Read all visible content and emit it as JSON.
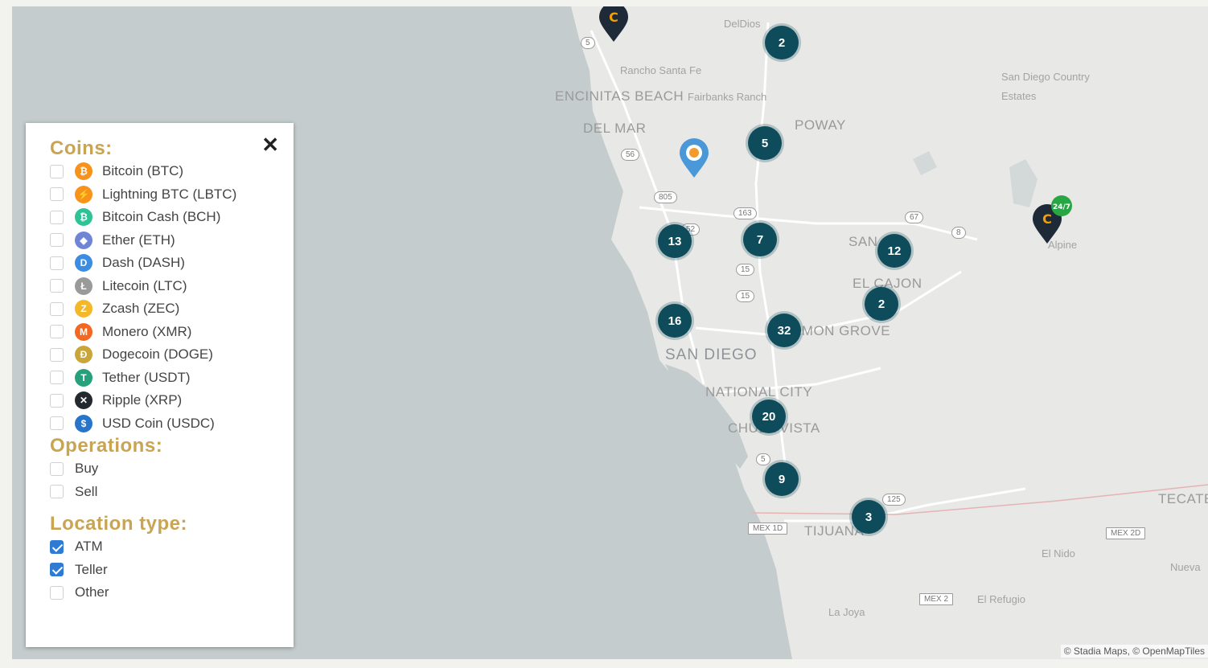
{
  "map": {
    "labels": [
      {
        "text": "DelDios",
        "cls": "small"
      },
      {
        "text": "Rancho Santa Fe",
        "cls": "small"
      },
      {
        "text": "ENCINITAS BEACH",
        "cls": ""
      },
      {
        "text": "Fairbanks Ranch",
        "cls": "small"
      },
      {
        "text": "DEL MAR",
        "cls": ""
      },
      {
        "text": "POWAY",
        "cls": ""
      },
      {
        "text": "San Diego Country Estates",
        "cls": "small"
      },
      {
        "text": "SAN",
        "cls": ""
      },
      {
        "text": "EL CAJON",
        "cls": ""
      },
      {
        "text": "LEMON GROVE",
        "cls": ""
      },
      {
        "text": "SAN DIEGO",
        "cls": "city"
      },
      {
        "text": "NATIONAL CITY",
        "cls": ""
      },
      {
        "text": "CHULA VISTA",
        "cls": ""
      },
      {
        "text": "TIJUANA",
        "cls": ""
      },
      {
        "text": "TECATE",
        "cls": ""
      },
      {
        "text": "Alpine",
        "cls": "small"
      },
      {
        "text": "El Nido",
        "cls": "small"
      },
      {
        "text": "El Refugio",
        "cls": "small"
      },
      {
        "text": "La Joya",
        "cls": "small"
      },
      {
        "text": "Nueva",
        "cls": "small"
      }
    ],
    "shields": [
      "5",
      "56",
      "805",
      "52",
      "163",
      "67",
      "8",
      "15",
      "15",
      "5",
      "125",
      "MEX 1D",
      "MEX 2D",
      "MEX 2"
    ],
    "clusters": [
      "2",
      "5",
      "13",
      "7",
      "12",
      "2",
      "16",
      "32",
      "20",
      "9",
      "3"
    ],
    "attribution": "© Stadia Maps, © OpenMapTiles"
  },
  "panel": {
    "close": "✕",
    "coins_title": "Coins:",
    "coins": [
      {
        "label": "Bitcoin (BTC)",
        "color": "#f7931a",
        "glyph": "₿"
      },
      {
        "label": "Lightning BTC (LBTC)",
        "color": "#f7931a",
        "glyph": "⚡"
      },
      {
        "label": "Bitcoin Cash (BCH)",
        "color": "#2dc396",
        "glyph": "₿"
      },
      {
        "label": "Ether (ETH)",
        "color": "#6f86d6",
        "glyph": "◆"
      },
      {
        "label": "Dash (DASH)",
        "color": "#3c8de1",
        "glyph": "D"
      },
      {
        "label": "Litecoin (LTC)",
        "color": "#9a9a9a",
        "glyph": "Ł"
      },
      {
        "label": "Zcash (ZEC)",
        "color": "#f4b728",
        "glyph": "Z"
      },
      {
        "label": "Monero (XMR)",
        "color": "#f26822",
        "glyph": "M"
      },
      {
        "label": "Dogecoin (DOGE)",
        "color": "#c9a63a",
        "glyph": "Ð"
      },
      {
        "label": "Tether (USDT)",
        "color": "#26a17b",
        "glyph": "T"
      },
      {
        "label": "Ripple (XRP)",
        "color": "#23292f",
        "glyph": "✕"
      },
      {
        "label": "USD Coin (USDC)",
        "color": "#2775ca",
        "glyph": "$"
      }
    ],
    "operations_title": "Operations:",
    "operations": [
      {
        "label": "Buy",
        "checked": false
      },
      {
        "label": "Sell",
        "checked": false
      }
    ],
    "location_title": "Location type:",
    "locations": [
      {
        "label": "ATM",
        "checked": true
      },
      {
        "label": "Teller",
        "checked": true
      },
      {
        "label": "Other",
        "checked": false
      }
    ]
  },
  "colors": {
    "accent": "#c9a452",
    "cluster": "#0e4c5b",
    "check": "#2f7ad3",
    "water": "#c4cccd",
    "land": "#e8e8e6"
  }
}
